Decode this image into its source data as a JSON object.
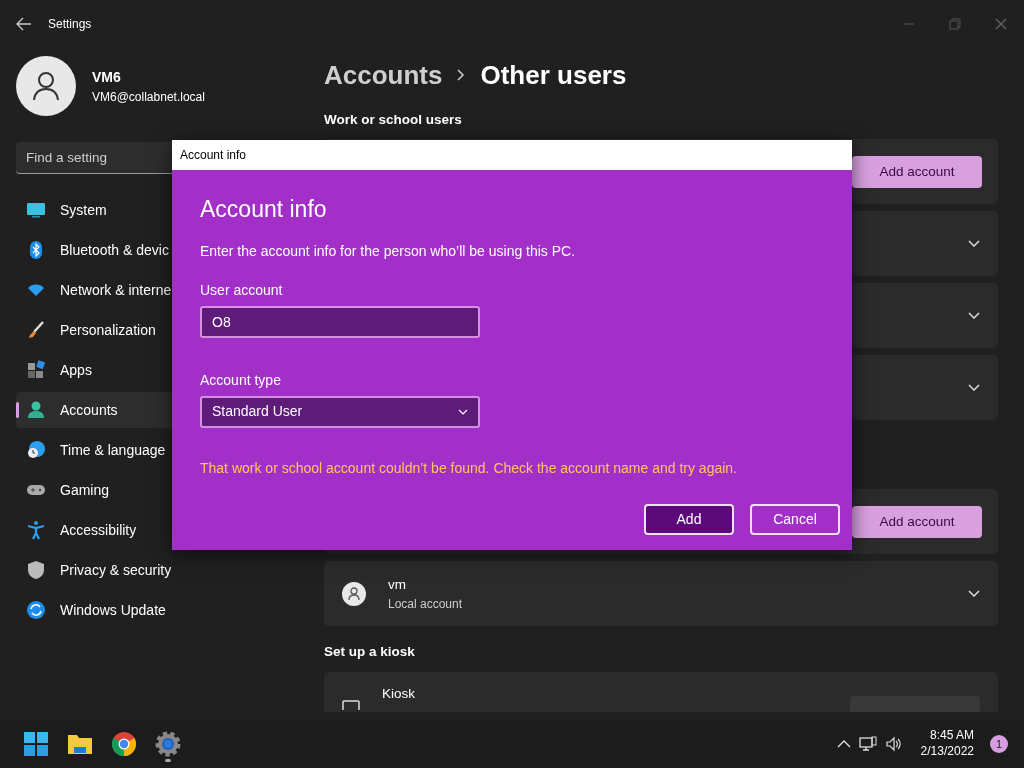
{
  "window": {
    "title": "Settings"
  },
  "user": {
    "name": "VM6",
    "email": "VM6@collabnet.local"
  },
  "search": {
    "placeholder": "Find a setting"
  },
  "nav": [
    {
      "label": "System",
      "selected": false
    },
    {
      "label": "Bluetooth & devic",
      "selected": false
    },
    {
      "label": "Network & interne",
      "selected": false
    },
    {
      "label": "Personalization",
      "selected": false
    },
    {
      "label": "Apps",
      "selected": false
    },
    {
      "label": "Accounts",
      "selected": true
    },
    {
      "label": "Time & language",
      "selected": false
    },
    {
      "label": "Gaming",
      "selected": false
    },
    {
      "label": "Accessibility",
      "selected": false
    },
    {
      "label": "Privacy & security",
      "selected": false
    },
    {
      "label": "Windows Update",
      "selected": false
    }
  ],
  "breadcrumb": {
    "parent": "Accounts",
    "current": "Other users"
  },
  "sections": [
    {
      "heading": "Work or school users",
      "rows": [
        {
          "kind": "action",
          "button": "Add account"
        },
        {
          "kind": "collapsed"
        },
        {
          "kind": "collapsed"
        },
        {
          "kind": "collapsed"
        }
      ]
    },
    {
      "rows": [
        {
          "kind": "action",
          "button": "Add account"
        },
        {
          "kind": "user",
          "name": "vm",
          "subtitle": "Local account"
        }
      ]
    },
    {
      "heading": "Set up a kiosk",
      "rows": [
        {
          "kind": "kiosk",
          "name": "Kiosk"
        }
      ]
    }
  ],
  "dialog": {
    "title_bar": "Account info",
    "heading": "Account info",
    "description": "Enter the account info for the person who’ll be using this PC.",
    "fields": [
      {
        "kind": "text",
        "label": "User account",
        "value": "O8"
      },
      {
        "kind": "select",
        "label": "Account type",
        "value": "Standard User"
      }
    ],
    "error": "That work or school account couldn’t be found. Check the account name and try again.",
    "buttons": [
      {
        "label": "Add",
        "kind": "primary"
      },
      {
        "label": "Cancel",
        "kind": "secondary"
      }
    ]
  },
  "taskbar": {
    "apps": [
      {
        "kind": "start",
        "running": false
      },
      {
        "kind": "explorer",
        "running": false
      },
      {
        "kind": "chrome",
        "running": false
      },
      {
        "kind": "settings",
        "running": true
      }
    ],
    "time": "8:45 AM",
    "date": "2/13/2022",
    "notifications": "1"
  }
}
